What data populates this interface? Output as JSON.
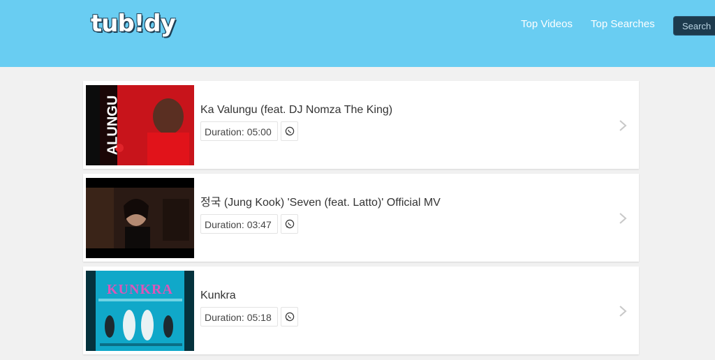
{
  "header": {
    "logo_text": "tub!dy",
    "nav": [
      {
        "label": "Top Videos"
      },
      {
        "label": "Top Searches"
      }
    ],
    "search_label": "Search",
    "bg_color": "#69cdf2"
  },
  "results": [
    {
      "title": "Ka Valungu (feat. DJ Nomza The King)",
      "duration": "Duration: 05:00",
      "thumb_text": "ALUNGU",
      "thumb_theme": "red"
    },
    {
      "title": "정국 (Jung Kook) 'Seven (feat. Latto)' Official MV",
      "duration": "Duration: 03:47",
      "thumb_theme": "dark"
    },
    {
      "title": "Kunkra",
      "duration": "Duration: 05:18",
      "thumb_text": "KUNKRA",
      "thumb_theme": "cyan"
    }
  ],
  "icons": {
    "share": "whatsapp-icon",
    "open": "chevron-right-icon"
  }
}
